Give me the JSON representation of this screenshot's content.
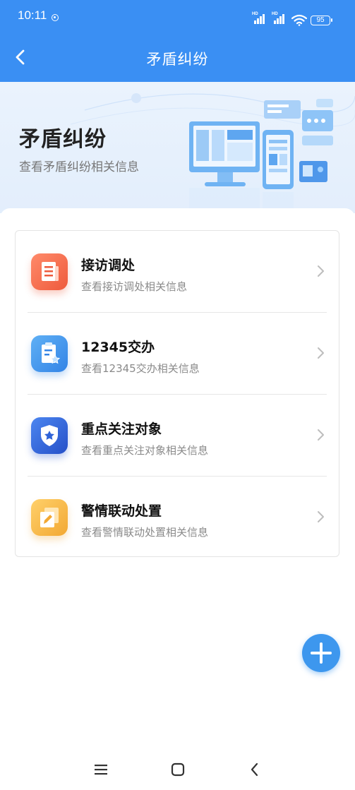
{
  "status_bar": {
    "time": "10:11",
    "battery": "95"
  },
  "header": {
    "title": "矛盾纠纷"
  },
  "banner": {
    "title": "矛盾纠纷",
    "subtitle": "查看矛盾纠纷相关信息"
  },
  "menu": {
    "items": [
      {
        "title": "接访调处",
        "desc": "查看接访调处相关信息",
        "icon": "document-icon",
        "color": "#f26a4c"
      },
      {
        "title": "12345交办",
        "desc": "查看12345交办相关信息",
        "icon": "clipboard-star-icon",
        "color": "#3d8ee8"
      },
      {
        "title": "重点关注对象",
        "desc": "查看重点关注对象相关信息",
        "icon": "shield-star-icon",
        "color": "#2f63d8"
      },
      {
        "title": "警情联动处置",
        "desc": "查看警情联动处置相关信息",
        "icon": "edit-copy-icon",
        "color": "#f3b13e"
      }
    ]
  },
  "colors": {
    "primary": "#3a8ff3",
    "fab": "#3d97ee"
  }
}
